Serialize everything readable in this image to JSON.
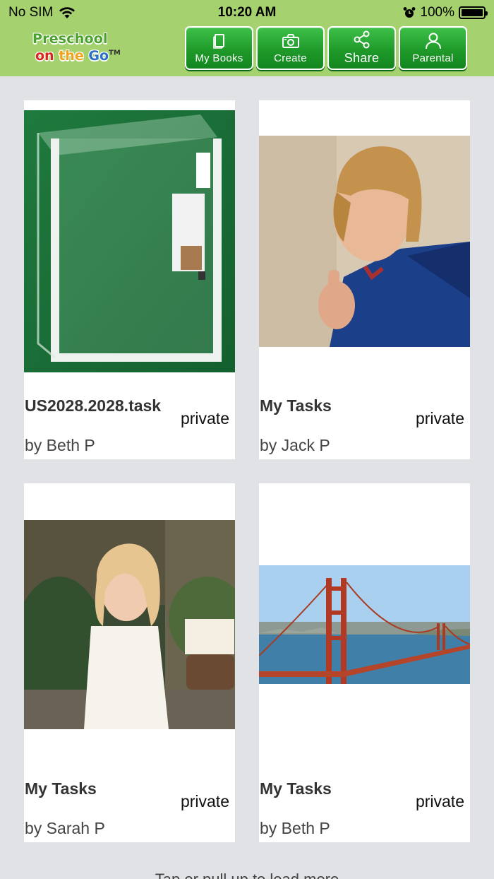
{
  "status_bar": {
    "carrier": "No SIM",
    "time": "10:20 AM",
    "battery": "100%"
  },
  "app": {
    "logo_line1": "Preschool",
    "logo_on": "on",
    "logo_the": "the",
    "logo_go": "Go",
    "logo_tm": "TM"
  },
  "nav": {
    "my_books": "My Books",
    "create": "Create",
    "share": "Share",
    "parental": "Parental"
  },
  "cards": [
    {
      "title": "US2028.2028.task",
      "visibility": "private",
      "author": "by Beth P",
      "image": "clear-acrylic-box-photo"
    },
    {
      "title": "My Tasks",
      "visibility": "private",
      "author": "by Jack P",
      "image": "boy-thumbs-up-photo"
    },
    {
      "title": "My Tasks",
      "visibility": "private",
      "author": "by Sarah P",
      "image": "girl-portrait-photo"
    },
    {
      "title": "My Tasks",
      "visibility": "private",
      "author": "by Beth P",
      "image": "golden-gate-bridge-photo"
    }
  ],
  "footer": {
    "load_more": "Tap or pull up to load more"
  }
}
